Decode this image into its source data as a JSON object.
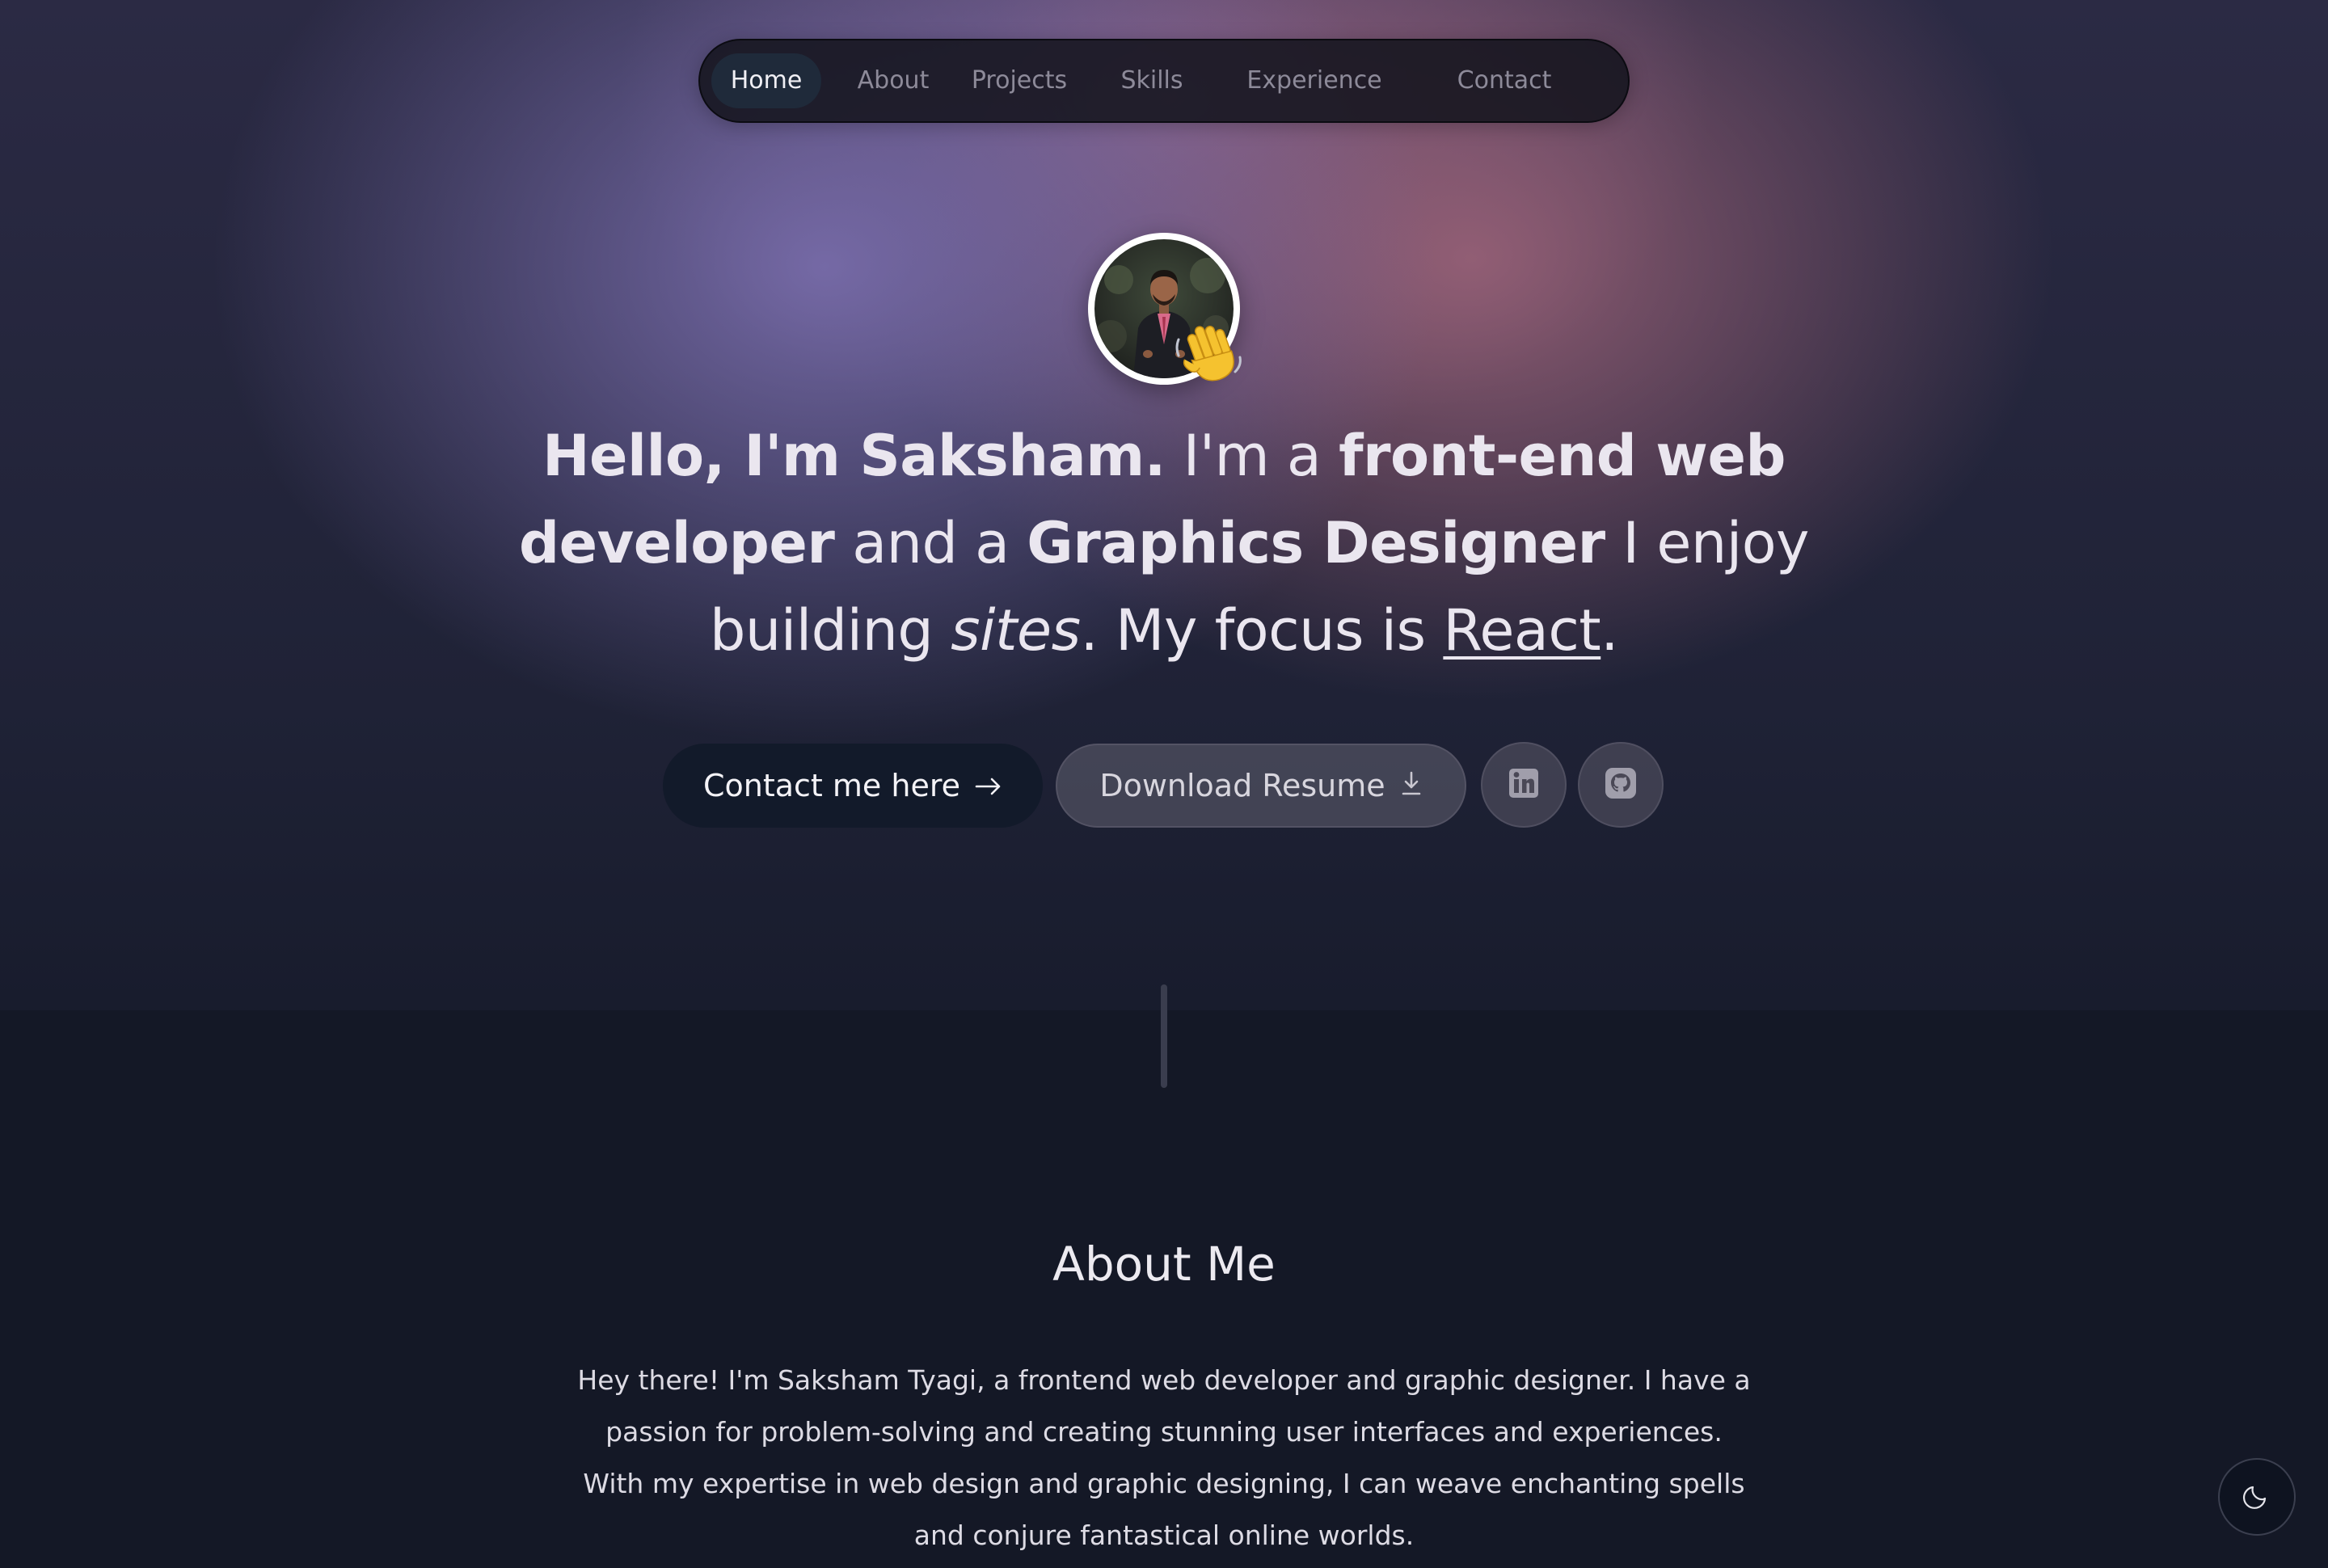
{
  "nav": {
    "items": [
      {
        "label": "Home",
        "active": true
      },
      {
        "label": "About",
        "active": false
      },
      {
        "label": "Projects",
        "active": false
      },
      {
        "label": "Skills",
        "active": false
      },
      {
        "label": "Experience",
        "active": false
      },
      {
        "label": "Contact",
        "active": false
      }
    ]
  },
  "hero": {
    "avatar_icon": "profile-photo",
    "wave_icon": "waving-hand-emoji",
    "headline": {
      "greeting": "Hello, I'm Saksham.",
      "im_a": "I'm a",
      "role1": "front-end web developer",
      "and_a": "and a",
      "role2": "Graphics Designer",
      "enjoy": "I enjoy building",
      "sites": "sites",
      "focus": ". My focus is",
      "react": "React",
      "end": "."
    },
    "buttons": {
      "contact_label": "Contact me here",
      "contact_icon": "arrow-right-icon",
      "resume_label": "Download Resume",
      "resume_icon": "download-icon",
      "linkedin_icon": "linkedin-icon",
      "github_icon": "github-icon"
    }
  },
  "about": {
    "title": "About Me",
    "text": "Hey there! I'm Saksham Tyagi, a frontend web developer and graphic designer. I have a passion for problem-solving and creating stunning user interfaces and experiences. With my expertise in web design and graphic designing, I can weave enchanting spells and conjure fantastical online worlds."
  },
  "theme_toggle": {
    "icon": "moon-icon"
  },
  "colors": {
    "background": "#141826",
    "nav_bg": "#14141e",
    "primary_button": "#121a2a",
    "text": "#eae6ef"
  }
}
